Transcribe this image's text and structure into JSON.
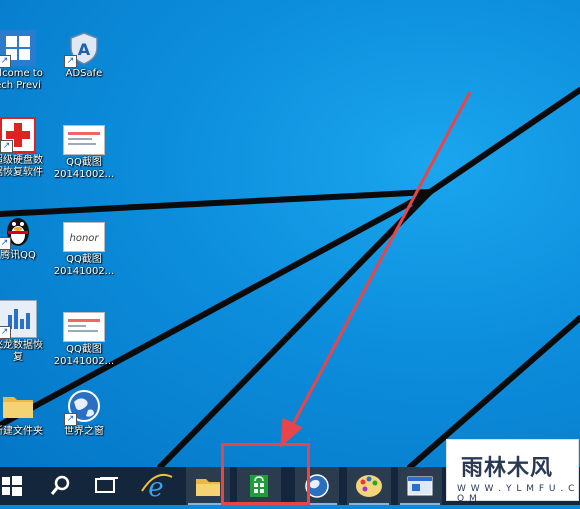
{
  "desktop_icons": [
    {
      "name": "welcome-tech-preview",
      "label": "elcome to\nech Previ"
    },
    {
      "name": "adsafe",
      "label": "ADSafe"
    },
    {
      "name": "disk-recovery",
      "label": "超级硬盘数\n据恢复软件"
    },
    {
      "name": "qq-screenshot-1",
      "label": "QQ截图\n20141002..."
    },
    {
      "name": "tencent-qq",
      "label": "腾讯QQ"
    },
    {
      "name": "qq-screenshot-2",
      "label": "QQ截图\n20141002..."
    },
    {
      "name": "data-recovery",
      "label": "飞龙数据恢\n复"
    },
    {
      "name": "qq-screenshot-3",
      "label": "QQ截图\n20141002..."
    },
    {
      "name": "new-folder",
      "label": "新建文件夹"
    },
    {
      "name": "world-window",
      "label": "世界之窗"
    }
  ],
  "taskbar": {
    "items": [
      "start-icon",
      "search-icon",
      "task-view-icon",
      "ie-icon",
      "file-explorer-icon",
      "store-icon",
      "globe-icon",
      "paint-icon",
      "window-icon"
    ],
    "active_item": "store-icon"
  },
  "annotation": {
    "color": "#e8454b"
  },
  "watermark": {
    "title": "雨林木风",
    "url": "W W W . Y L M F U . C O M"
  },
  "colors": {
    "desktop": "#0c8ddc",
    "taskbar": "#13263b",
    "store": "#1e9e3a"
  }
}
